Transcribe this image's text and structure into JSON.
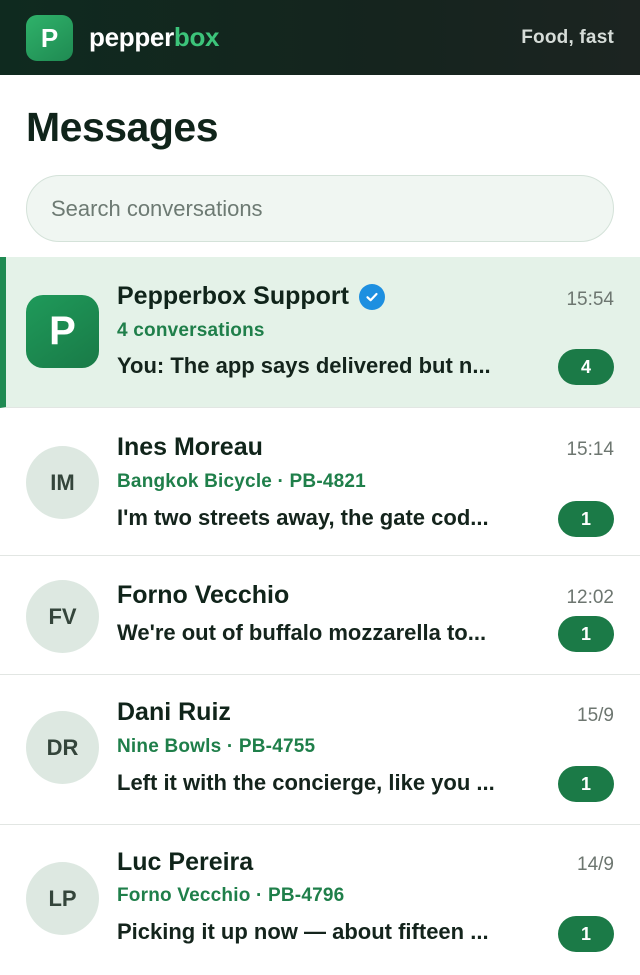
{
  "app": {
    "logo_letter": "P",
    "brand_main": "pepper",
    "brand_accent": "box",
    "tagline": "Food, fast"
  },
  "page": {
    "title": "Messages"
  },
  "search": {
    "placeholder": "Search conversations",
    "value": ""
  },
  "colors": {
    "brand_green": "#1f8a52",
    "accent_green": "#3cc47a",
    "verified_blue": "#1d8fe0",
    "active_row_bg": "#e4f2e8"
  },
  "conversations": [
    {
      "avatar": "P",
      "name": "Pepperbox Support",
      "verified": true,
      "time": "15:54",
      "sub": "4 conversations",
      "preview": "You: The app says delivered but n...",
      "unread": "4"
    },
    {
      "avatar": "IM",
      "name": "Ines Moreau",
      "time": "15:14",
      "sub": "Bangkok Bicycle · PB-4821",
      "preview": "I'm two streets away, the gate cod...",
      "unread": "1"
    },
    {
      "avatar": "FV",
      "name": "Forno Vecchio",
      "time": "12:02",
      "preview": "We're out of buffalo mozzarella to...",
      "unread": "1"
    },
    {
      "avatar": "DR",
      "name": "Dani Ruiz",
      "time": "15/9",
      "sub": "Nine Bowls · PB-4755",
      "preview": "Left it with the concierge, like you ...",
      "unread": "1"
    },
    {
      "avatar": "LP",
      "name": "Luc Pereira",
      "time": "14/9",
      "sub": "Forno Vecchio · PB-4796",
      "preview": "Picking it up now — about fifteen ...",
      "unread": "1"
    }
  ]
}
